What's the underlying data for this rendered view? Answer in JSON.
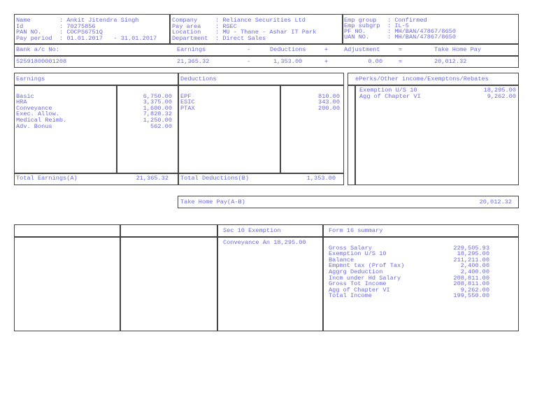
{
  "employee": {
    "name_label": "Name",
    "name": ": Ankit Jitendra Singh",
    "id_label": "Id",
    "id": ": 70275856",
    "pan_label": "PAN NO.",
    "pan": ": COCPS6751Q",
    "period_label": "Pay period",
    "period": ": 01.01.2017   - 31.01.2017"
  },
  "company": {
    "company_label": "Company",
    "company": ": Reliance Securities Ltd",
    "payarea_label": "Pay area",
    "payarea": ": RSEC",
    "location_label": "Location",
    "location": ": MU - Thane - Ashar IT Park",
    "dept_label": "Department",
    "dept": ": Direct Sales"
  },
  "group": {
    "group_label": "Emp group",
    "group": ": Confirmed",
    "subgrp_label": "Emp subgrp",
    "subgrp": ": IL-5",
    "pf_label": "PF NO.",
    "pf": ": MH/BAN/47867/8650",
    "uan_label": "UAN NO.",
    "uan": ": MH/BAN/47867/8650"
  },
  "summary": {
    "bank_label": "Bank a/c No:",
    "bank": "52591800001208",
    "earnings_label": "Earnings",
    "earnings": "21,365.32",
    "minus": "-",
    "deductions_label": "Deductions",
    "deductions": "1,353.00",
    "plus": "+",
    "adjustment_label": "Adjustment",
    "adjustment": "0.00",
    "equals": "=",
    "takehome_label": "Take Home Pay",
    "takehome": "20,012.32"
  },
  "earnings": {
    "title": "Earnings",
    "items": [
      {
        "label": "Basic",
        "value": "6,750.00"
      },
      {
        "label": "HRA",
        "value": "3,375.00"
      },
      {
        "label": "Conveyance",
        "value": "1,600.00"
      },
      {
        "label": "Exec. Allow.",
        "value": "7,828.32"
      },
      {
        "label": "Medical Reimb.",
        "value": "1,250.00"
      },
      {
        "label": "Adv. Bonus",
        "value": "562.00"
      }
    ],
    "total_label": "Total Earnings(A)",
    "total": "21,365.32"
  },
  "deductions": {
    "title": "Deductions",
    "items": [
      {
        "label": "EPF",
        "value": "810.00"
      },
      {
        "label": "ESIC",
        "value": "343.00"
      },
      {
        "label": "PTAX",
        "value": "200.00"
      }
    ],
    "total_label": "Total Deductions(B)",
    "total": "1,353.00"
  },
  "perks": {
    "title": "ePerks/Other income/Exemptons/Rebates",
    "items": [
      {
        "label": "Exemption U/S 10",
        "value": "18,295.00"
      },
      {
        "label": "Agg of Chapter VI",
        "value": "9,262.00"
      }
    ]
  },
  "takehome": {
    "label": "Take Home Pay(A-B)",
    "value": "20,012.32"
  },
  "sec10": {
    "title": "Sec 10 Exemption",
    "item": "Conveyance An 18,295.00"
  },
  "form16": {
    "title": "Form 16 summary",
    "items": [
      {
        "label": "Gross Salary",
        "value": "229,505.93"
      },
      {
        "label": "Exemption U/S 10",
        "value": "18,295.00"
      },
      {
        "label": "Balance",
        "value": "211,211.00"
      },
      {
        "label": "Empmnt tax (Prof Tax)",
        "value": "2,400.00"
      },
      {
        "label": "Aggrg Deduction",
        "value": "2,400.00"
      },
      {
        "label": "Incm under Hd Salary",
        "value": "208,811.00"
      },
      {
        "label": "Gross Tot Income",
        "value": "208,811.00"
      },
      {
        "label": "Agg of Chapter VI",
        "value": "9,262.00"
      },
      {
        "label": "Total Income",
        "value": "199,550.00"
      }
    ]
  }
}
